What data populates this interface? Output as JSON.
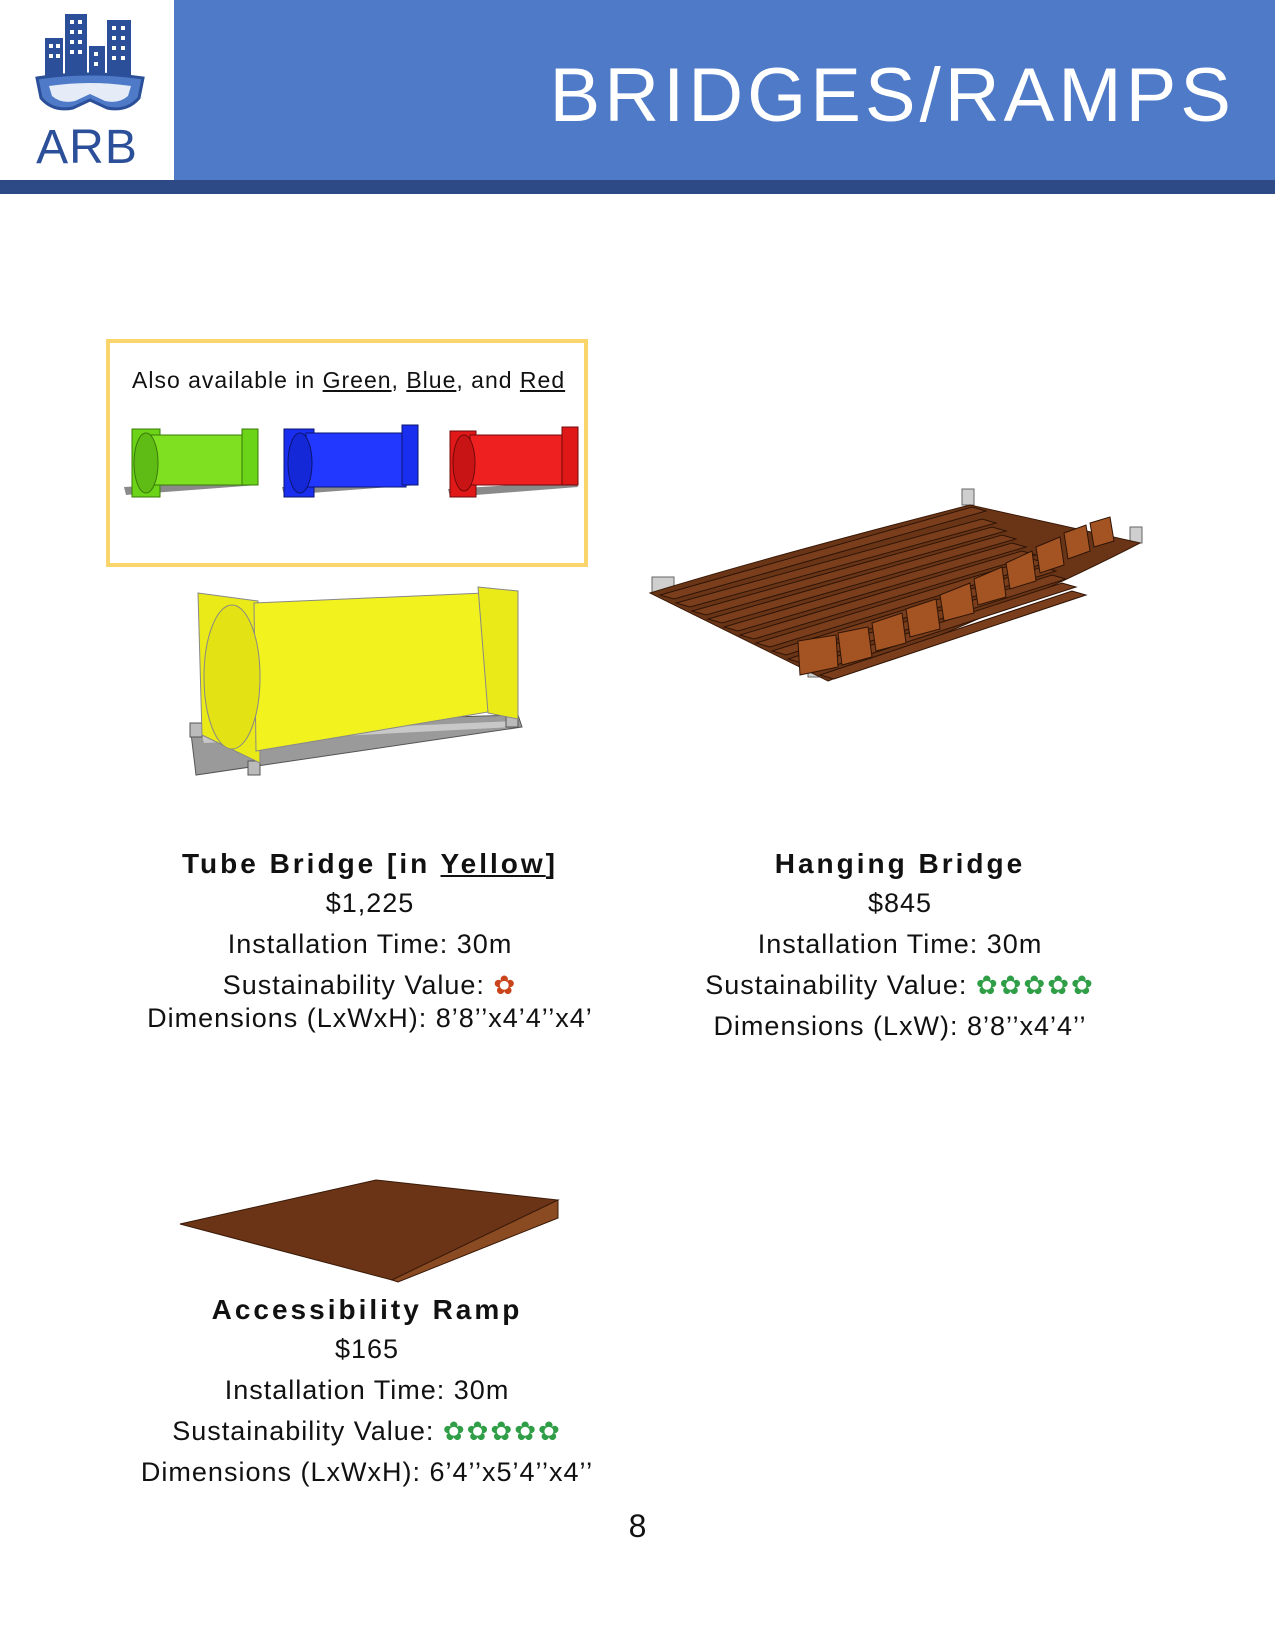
{
  "header": {
    "logo_text": "ARB",
    "title": "BRIDGES/RAMPS",
    "accent_color": "#4f7ac8",
    "rule_color": "#2d4a86"
  },
  "color_options": {
    "prefix": "Also available in ",
    "green": "Green",
    "sep1": ", ",
    "blue": "Blue",
    "sep2": ", and ",
    "red": "Red"
  },
  "products": {
    "tube": {
      "title_prefix": "Tube Bridge [in ",
      "title_color": "Yellow",
      "title_suffix": "]",
      "price": "$1,225",
      "install": "Installation Time: 30m",
      "sustain_label": "Sustainability Value: ",
      "sustain_flowers": "✿",
      "sustain_rating": 1,
      "dimensions": "Dimensions (LxWxH): 8’8’’x4’4’’x4’"
    },
    "hanging": {
      "title": "Hanging Bridge",
      "price": "$845",
      "install": "Installation Time: 30m",
      "sustain_label": "Sustainability Value: ",
      "sustain_flowers": "✿✿✿✿✿",
      "sustain_rating": 5,
      "dimensions": "Dimensions (LxW): 8’8’’x4’4’’"
    },
    "ramp": {
      "title": "Accessibility Ramp",
      "price": "$165",
      "install": "Installation Time: 30m",
      "sustain_label": "Sustainability Value: ",
      "sustain_flowers": "✿✿✿✿✿",
      "sustain_rating": 5,
      "dimensions": "Dimensions (LxWxH): 6’4’’x5’4’’x4’’"
    }
  },
  "page_number": "8"
}
